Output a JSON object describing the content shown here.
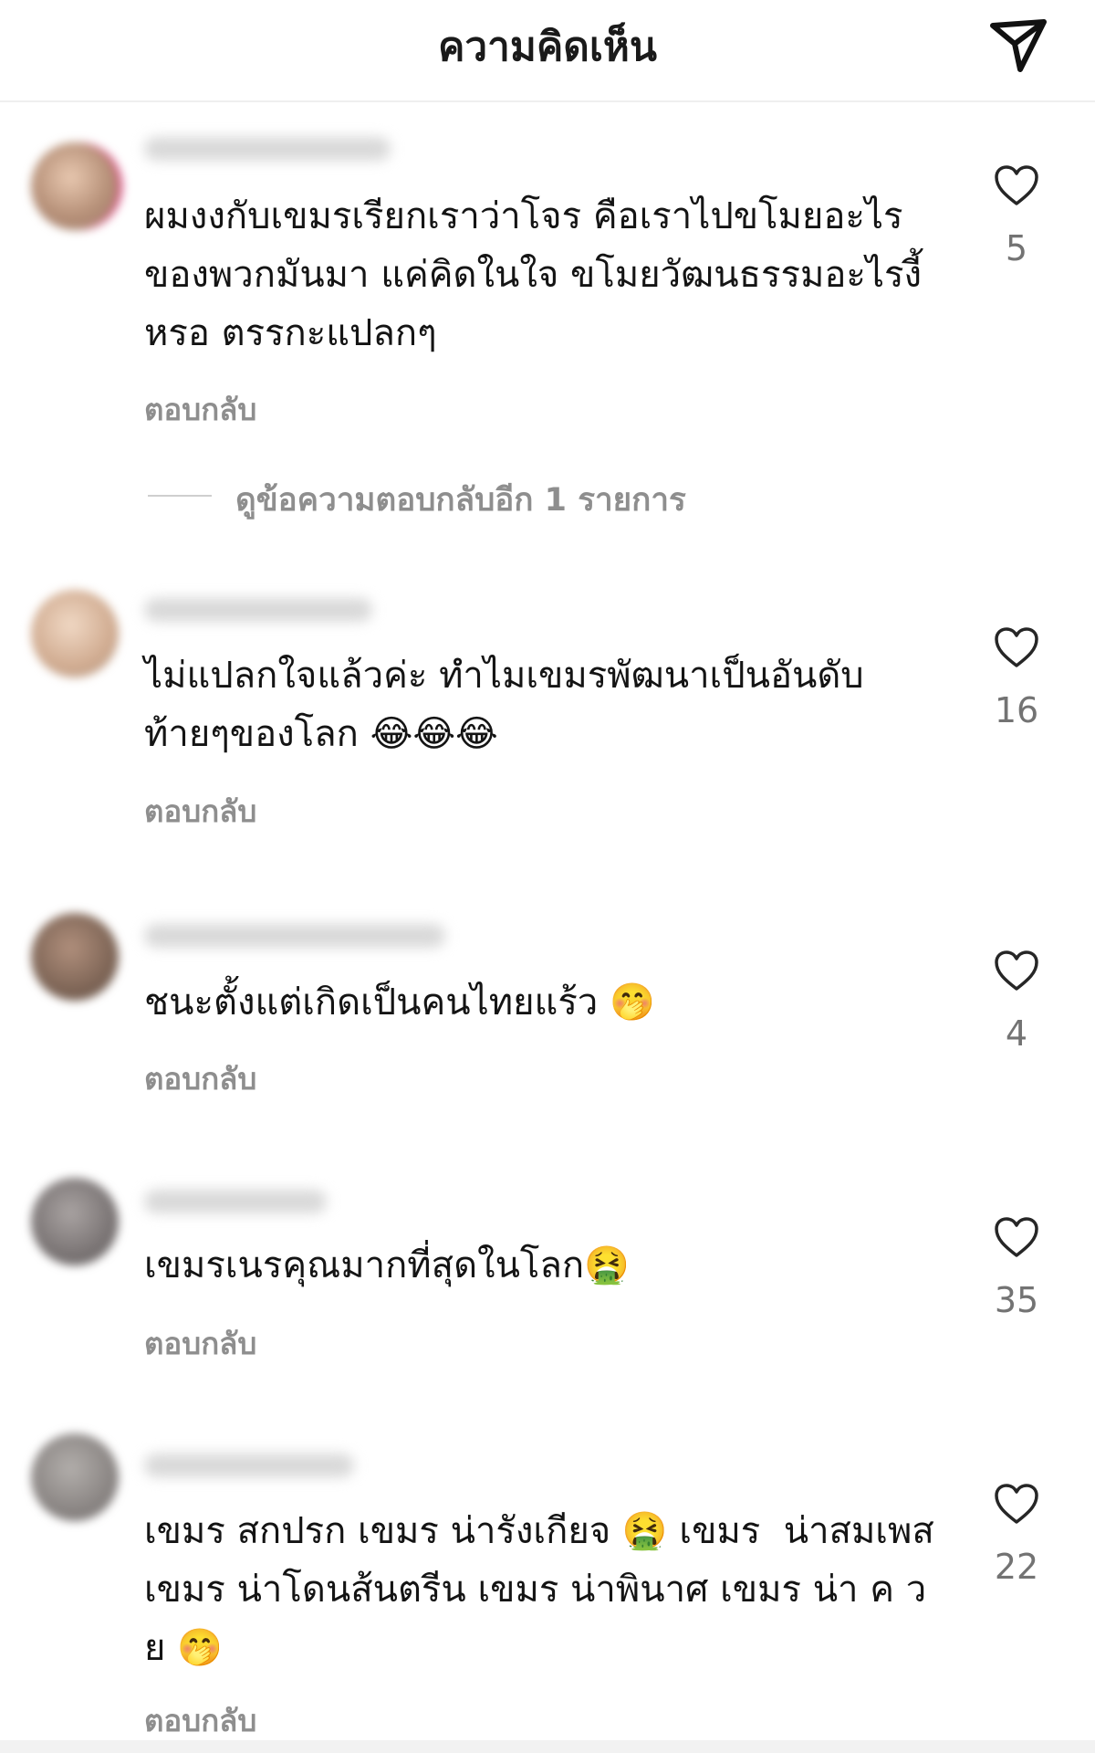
{
  "header": {
    "title": "ความคิดเห็น",
    "send_icon": "paper-plane-icon"
  },
  "comments": [
    {
      "text": "ผมงงกับเขมรเรียกเราว่าโจร คือเราไปขโมยอะไรของพวกมันมา แค่คิดในใจ ขโมยวัฒนธรรมอะไรงี้หรอ ตรรกะแปลกๆ",
      "reply_label": "ตอบกลับ",
      "likes": "5",
      "view_replies": "ดูข้อความตอบกลับอีก 1 รายการ",
      "avatar_color": "#c9a48c"
    },
    {
      "text": "ไม่แปลกใจแล้วค่ะ ทำไมเขมรพัฒนาเป็นอันดับท้ายๆของโลก 😂😂😂",
      "reply_label": "ตอบกลับ",
      "likes": "16",
      "avatar_color": "#d4b49a"
    },
    {
      "text": "ชนะตั้งแต่เกิดเป็นคนไทยแร้ว 🤭",
      "reply_label": "ตอบกลับ",
      "likes": "4",
      "avatar_color": "#8f7462"
    },
    {
      "text": "เขมรเนรคุณมากที่สุดในโลก🤮",
      "reply_label": "ตอบกลับ",
      "likes": "35",
      "avatar_color": "#7f7a7a"
    },
    {
      "text": "เขมร สกปรก เขมร น่ารังเกียจ 🤮 เขมร  น่าสมเพส เขมร น่าโดนส้นตรีน เขมร น่าพินาศ เขมร น่า ค ว ย 🤭",
      "reply_label": "ตอบกลับ",
      "likes": "22",
      "avatar_color": "#8e8a88"
    }
  ],
  "colors": {
    "text": "#141414",
    "secondary": "#8e8e8e",
    "like_count": "#737373",
    "heart_stroke": "#262626"
  }
}
